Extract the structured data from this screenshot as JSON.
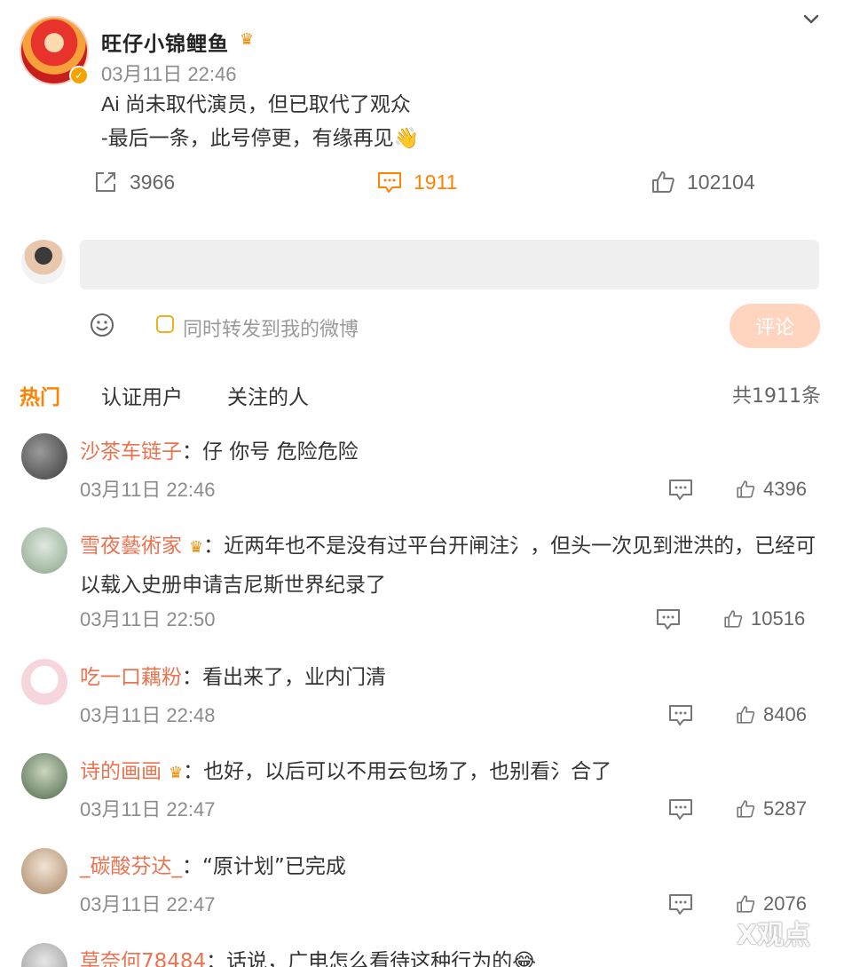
{
  "post": {
    "author": "旺仔小锦鲤鱼",
    "time": "03月11日 22:46",
    "line1": "Ai 尚未取代演员，但已取代了观众",
    "line2": "-最后一条，此号停更，有缘再见👋",
    "reposts": "3966",
    "comments": "1911",
    "likes": "102104"
  },
  "composer": {
    "placeholder": "",
    "repost_label": "同时转发到我的微博",
    "submit_label": "评论"
  },
  "tabs": {
    "hot": "热门",
    "verified": "认证用户",
    "following": "关注的人",
    "total": "共1911条"
  },
  "comments": [
    {
      "name": "沙茶车链子",
      "sep": "：",
      "text": "仔 你号 危险危险",
      "time": "03月11日 22:46",
      "likes": "4396"
    },
    {
      "name": "雪夜藝術家",
      "sep": "：",
      "text": "近两年也不是没有过平台开闸注氵，但头一次见到泄洪的，已经可以载入史册申请吉尼斯世界纪录了",
      "time": "03月11日 22:50",
      "likes": "10516"
    },
    {
      "name": "吃一口藕粉",
      "sep": "：",
      "text": "看出来了，业内门清",
      "time": "03月11日 22:48",
      "likes": "8406"
    },
    {
      "name": "诗的画画",
      "sep": "：",
      "text": "也好，以后可以不用云包场了，也别看氵合了",
      "time": "03月11日 22:47",
      "likes": "5287"
    },
    {
      "name": "_碳酸芬达_",
      "sep": "：",
      "text": "“原计划”已完成",
      "time": "03月11日 22:47",
      "likes": "2076"
    },
    {
      "name": "草奈何78484",
      "sep": "：",
      "text": "话说，广电怎么看待这种行为的😂",
      "time": "",
      "likes": ""
    }
  ],
  "watermark": "X观点",
  "colors": {
    "accent": "#ff8200",
    "username": "#eb7350",
    "submit_bg": "#ffd5bf"
  },
  "icons": [
    "chevron-down-icon",
    "repost-icon",
    "comment-icon",
    "like-icon",
    "smile-icon",
    "crown-icon",
    "verified-icon"
  ]
}
